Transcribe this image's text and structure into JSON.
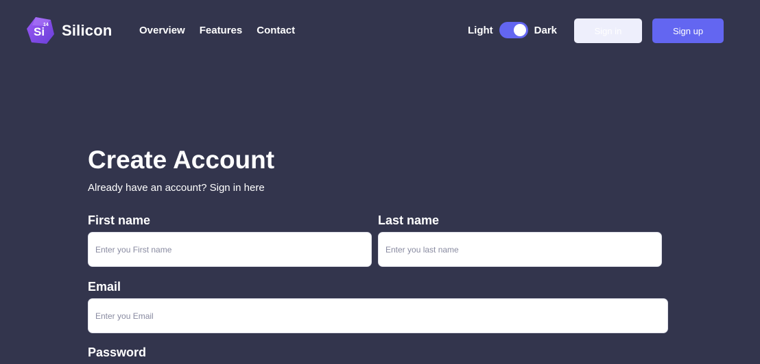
{
  "brand": {
    "logo_badge": "Si",
    "logo_number": "14",
    "name": "Silicon",
    "accent": "#6366f1",
    "background": "#33354d"
  },
  "nav": {
    "items": [
      {
        "label": "Overview"
      },
      {
        "label": "Features"
      },
      {
        "label": "Contact"
      }
    ]
  },
  "theme": {
    "light_label": "Light",
    "dark_label": "Dark",
    "mode": "dark"
  },
  "header_actions": {
    "signin_label": "Sign in",
    "signup_label": "Sign up"
  },
  "form": {
    "title": "Create Account",
    "subtitle": "Already have an account? Sign in here",
    "first_name": {
      "label": "First name",
      "placeholder": "Enter you First name"
    },
    "last_name": {
      "label": "Last name",
      "placeholder": "Enter you last name"
    },
    "email": {
      "label": "Email",
      "placeholder": "Enter you Email"
    },
    "password": {
      "label": "Password"
    }
  }
}
